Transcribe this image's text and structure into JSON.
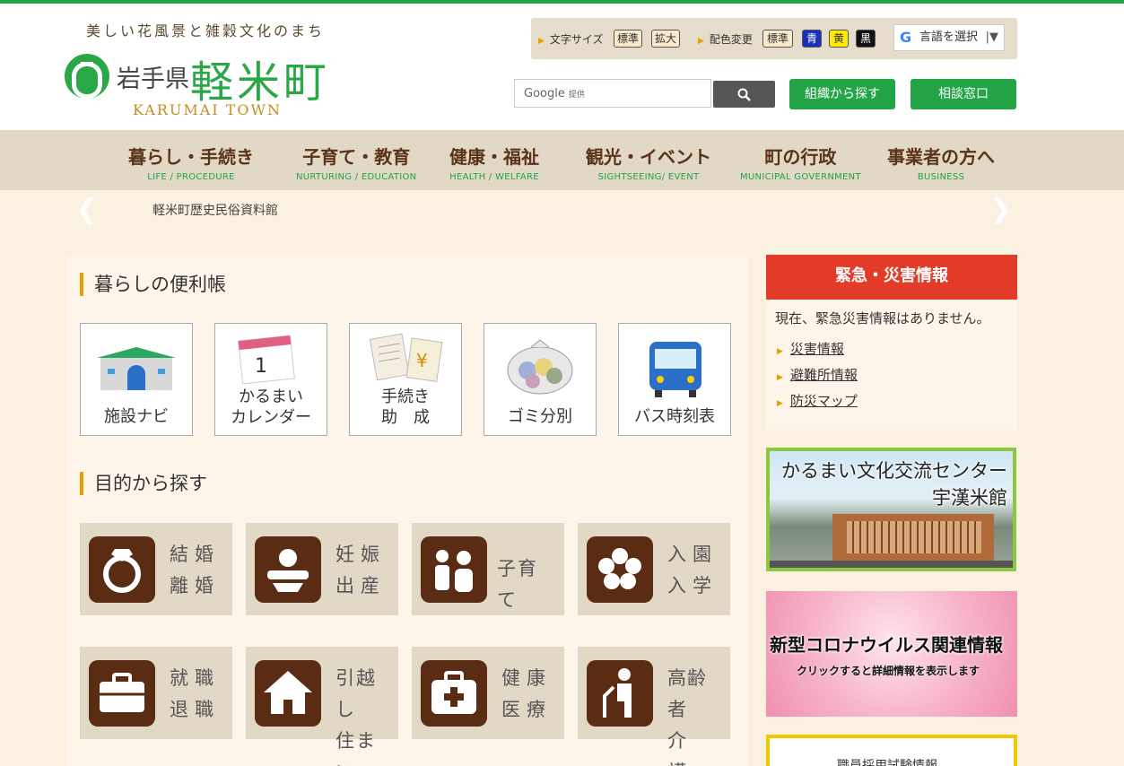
{
  "header": {
    "tagline": "美しい花風景と雑穀文化のまち",
    "logo": {
      "pref": "岩手県",
      "town": "軽米町",
      "en": "KARUMAI TOWN"
    }
  },
  "utility": {
    "text_size_label": "文字サイズ",
    "text_size_options": [
      "標準",
      "拡大"
    ],
    "color_label": "配色変更",
    "color_options": [
      "標準",
      "青",
      "黄",
      "黒"
    ],
    "language_select": "言語を選択"
  },
  "search": {
    "placeholder": "Google",
    "provided": "提供"
  },
  "buttons": {
    "org_search": "組織から探す",
    "consult": "相談窓口"
  },
  "nav": [
    {
      "jp": "暮らし・手続き",
      "en": "LIFE / PROCEDURE"
    },
    {
      "jp": "子育て・教育",
      "en": "NURTURING / EDUCATION"
    },
    {
      "jp": "健康・福祉",
      "en": "HEALTH / WELFARE"
    },
    {
      "jp": "観光・イベント",
      "en": "SIGHTSEEING/ EVENT"
    },
    {
      "jp": "町の行政",
      "en": "MUNICIPAL GOVERNMENT"
    },
    {
      "jp": "事業者の方へ",
      "en": "BUSINESS"
    }
  ],
  "news": {
    "item": "軽米町歴史民俗資料館"
  },
  "convenience": {
    "title": "暮らしの便利帳",
    "tiles": [
      {
        "l1": "施設ナビ",
        "l2": ""
      },
      {
        "l1": "かるまい",
        "l2": "カレンダー"
      },
      {
        "l1": "手続き",
        "l2": "助　成"
      },
      {
        "l1": "ゴミ分別",
        "l2": ""
      },
      {
        "l1": "バス時刻表",
        "l2": ""
      }
    ]
  },
  "purpose": {
    "title": "目的から探す",
    "tiles": [
      {
        "l1": "結婚",
        "l2": "離婚",
        "icon": "ring-icon"
      },
      {
        "l1": "妊娠",
        "l2": "出産",
        "icon": "baby-icon"
      },
      {
        "l1": "子育て",
        "l2": "",
        "icon": "parent-child-icon"
      },
      {
        "l1": "入園",
        "l2": "入学",
        "icon": "cherry-blossom-icon"
      },
      {
        "l1": "就職",
        "l2": "退職",
        "icon": "briefcase-icon"
      },
      {
        "l1": "引越し",
        "l2": "住まい",
        "icon": "house-icon"
      },
      {
        "l1": "健康",
        "l2": "医療",
        "icon": "first-aid-icon"
      },
      {
        "l1": "高齢者",
        "l2": "介　護",
        "icon": "elderly-icon"
      }
    ]
  },
  "emergency": {
    "title": "緊急・災害情報",
    "message": "現在、緊急災害情報はありません。",
    "links": [
      "災害情報",
      "避難所情報",
      "防災マップ"
    ]
  },
  "banners": {
    "center_l1": "かるまい文化交流センター",
    "center_l2": "宇漢米館",
    "corona_title": "新型コロナウイルス関連情報",
    "corona_sub": "クリックすると詳細情報を表示します",
    "recruit": "職員採用試験情報"
  },
  "colors": {
    "brand_green": "#22a447",
    "accent_orange": "#e8a000",
    "emergency_red": "#e23b28",
    "nav_brown": "#5a3418"
  }
}
